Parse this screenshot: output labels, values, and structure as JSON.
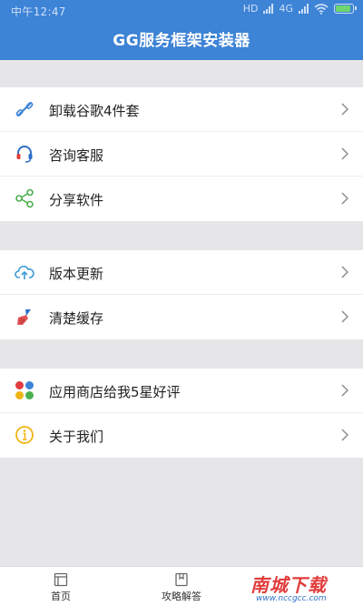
{
  "status": {
    "time": "中午12:47",
    "network": "4G",
    "network_hd": "HD"
  },
  "header": {
    "title": "GG服务框架安装器"
  },
  "sections": [
    {
      "items": [
        {
          "label": "卸载谷歌4件套",
          "icon": "link-icon"
        },
        {
          "label": "咨询客服",
          "icon": "headset-icon"
        },
        {
          "label": "分享软件",
          "icon": "share-icon"
        }
      ]
    },
    {
      "items": [
        {
          "label": "版本更新",
          "icon": "cloud-upload-icon"
        },
        {
          "label": "清楚缓存",
          "icon": "broom-icon"
        }
      ]
    },
    {
      "items": [
        {
          "label": "应用商店给我5星好评",
          "icon": "app-store-icon"
        },
        {
          "label": "关于我们",
          "icon": "info-icon"
        }
      ]
    }
  ],
  "tabbar": {
    "tabs": [
      {
        "label": "首页",
        "icon": "home-icon"
      },
      {
        "label": "攻略解答",
        "icon": "book-icon"
      }
    ]
  },
  "watermark": {
    "text": "南城下载",
    "url": "www.nccgcc.com"
  },
  "colors": {
    "header_bg": "#3d83d6",
    "page_bg": "#e6e6e8",
    "accent_red": "#e23c3c",
    "accent_green": "#4caf50",
    "accent_blue": "#3d83d6",
    "accent_yellow": "#f0b416"
  }
}
